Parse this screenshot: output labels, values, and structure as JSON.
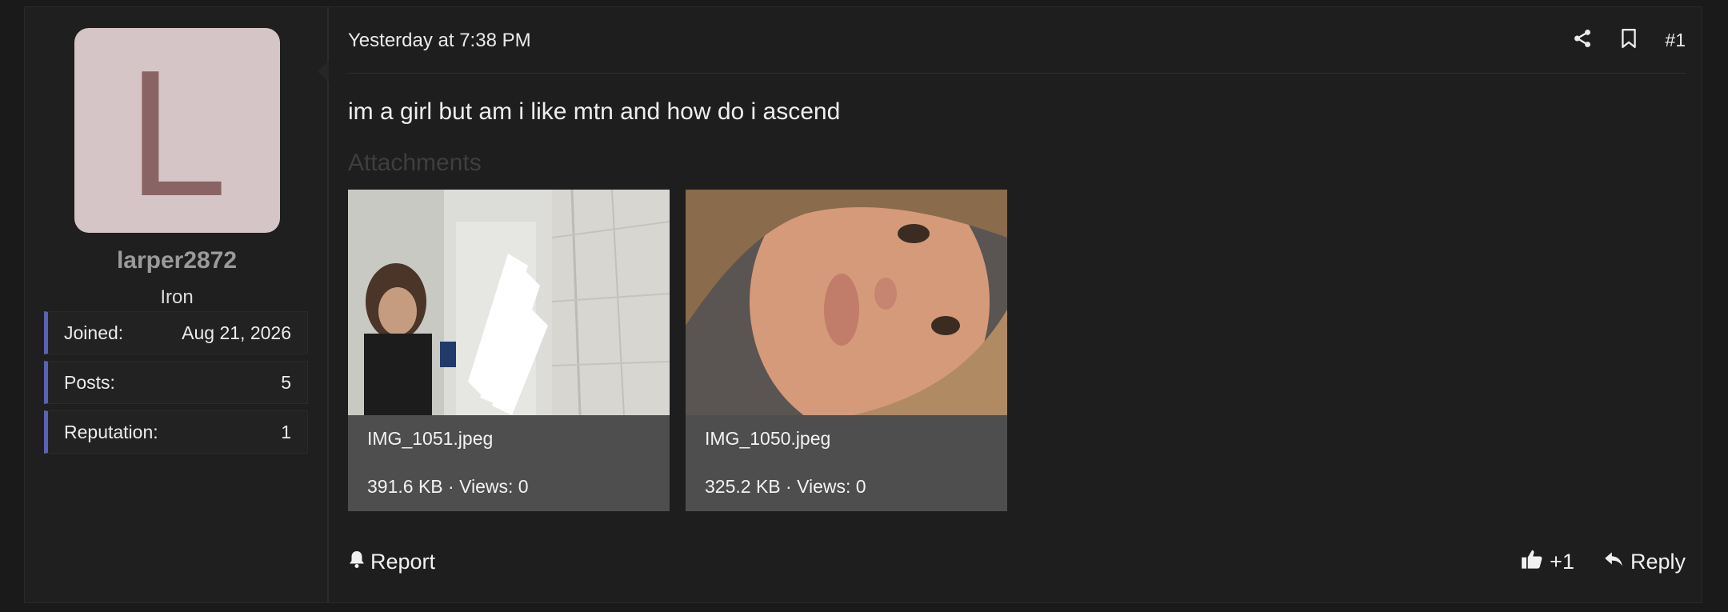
{
  "user": {
    "avatar_letter": "L",
    "username": "larper2872",
    "rank": "Iron",
    "stats": [
      {
        "label": "Joined:",
        "value": "Aug 21, 2026"
      },
      {
        "label": "Posts:",
        "value": "5"
      },
      {
        "label": "Reputation:",
        "value": "1"
      }
    ]
  },
  "post": {
    "timestamp": "Yesterday at 7:38 PM",
    "number": "#1",
    "message": "im a girl but am i like mtn and how do i ascend",
    "attachments_title": "Attachments",
    "attachments": [
      {
        "name": "IMG_1051.jpeg",
        "meta": "391.6 KB · Views: 0"
      },
      {
        "name": "IMG_1050.jpeg",
        "meta": "325.2 KB · Views: 0"
      }
    ]
  },
  "actions": {
    "report": "Report",
    "like_count": "+1",
    "reply": "Reply"
  },
  "icons": {
    "share": "share-icon",
    "bookmark": "bookmark-icon",
    "report": "bell-icon",
    "like": "thumbs-up-icon",
    "reply": "reply-arrow-icon"
  },
  "colors": {
    "background": "#1a1a1a",
    "stat_accent": "#5a62b5",
    "avatar_bg": "#d6c5c6",
    "avatar_letter": "#8a6465"
  }
}
